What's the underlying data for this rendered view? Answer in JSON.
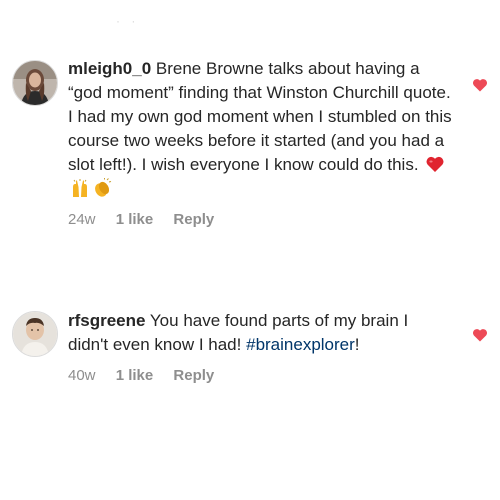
{
  "top_indicator": "·   ·",
  "comments": [
    {
      "username": "mleigh0_0",
      "text": "Brene Browne talks about having a “god moment” finding that Winston Churchill quote. I had my own god moment when I stumbled on this course two weeks before it started (and you had a slot left!). I wish everyone I know could do this.",
      "emojis": [
        "red-heart",
        "raising-hands",
        "clapping-hands"
      ],
      "time": "24w",
      "likes": "1 like",
      "reply": "Reply"
    },
    {
      "username": "rfsgreene",
      "text_before": "You have found parts of my brain I didn't even know I had!",
      "hashtag": "#brainexplorer",
      "text_after": "!",
      "time": "40w",
      "likes": "1 like",
      "reply": "Reply"
    }
  ],
  "colors": {
    "heart": "#ed4956",
    "meta_text": "#8e8e8e",
    "hashtag": "#003569",
    "body_text": "#262626"
  }
}
